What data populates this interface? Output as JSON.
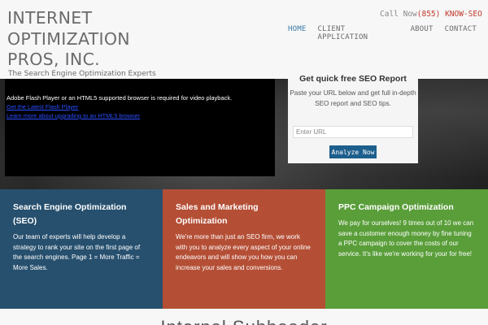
{
  "header": {
    "logo_lines": [
      "INTERNET",
      "OPTIMIZATION",
      "PROS, INC."
    ],
    "tagline": "The Search Engine Optimization Experts",
    "call_label": "Call Now",
    "phone": "(855) KNOW-SEO"
  },
  "nav": {
    "items": [
      {
        "label": "HOME",
        "active": true
      },
      {
        "label": "CLIENT APPLICATION",
        "active": false
      },
      {
        "label": "ABOUT",
        "active": false
      },
      {
        "label": "CONTACT",
        "active": false
      }
    ]
  },
  "hero": {
    "flash_message": "Adobe Flash Player or an HTML5 supported browser is required for video playback.",
    "flash_link_1": "Get the Latest Flash Player",
    "flash_link_2": "Learn more about upgrading to an HTML5 browser",
    "form": {
      "title": "Get quick free SEO Report",
      "text": "Paste your URL below and get full in-depth SEO report and SEO tips.",
      "input_placeholder": "Enter URL",
      "button_label": "Analyze Now"
    }
  },
  "features": [
    {
      "title": "Search Engine Optimization (SEO)",
      "text": "Our team of experts will help develop a strategy to rank your site on the first page of the search engines.       Page 1 = More Traffic = More Sales.",
      "color": "#27506e"
    },
    {
      "title": "Sales and Marketing Optimization",
      "text": "We're more than just an SEO firm, we work with you to analyze every aspect of your online endeavors and will show you how you can increase your sales and conversions.",
      "color": "#b44f36"
    },
    {
      "title": "PPC Campaign Optimization",
      "text": "We pay for ourselves! 9 times out of 10 we can save a customer enough money by fine tuning a PPC campaign to cover the costs of our service. It's like we're working for your for free!",
      "color": "#5a9e3a"
    }
  ],
  "bottom": {
    "subheader": "Internal Subheader"
  },
  "colors": {
    "accent": "#3a7aa3",
    "phone": "#c0392b",
    "button": "#1c5e8c"
  }
}
